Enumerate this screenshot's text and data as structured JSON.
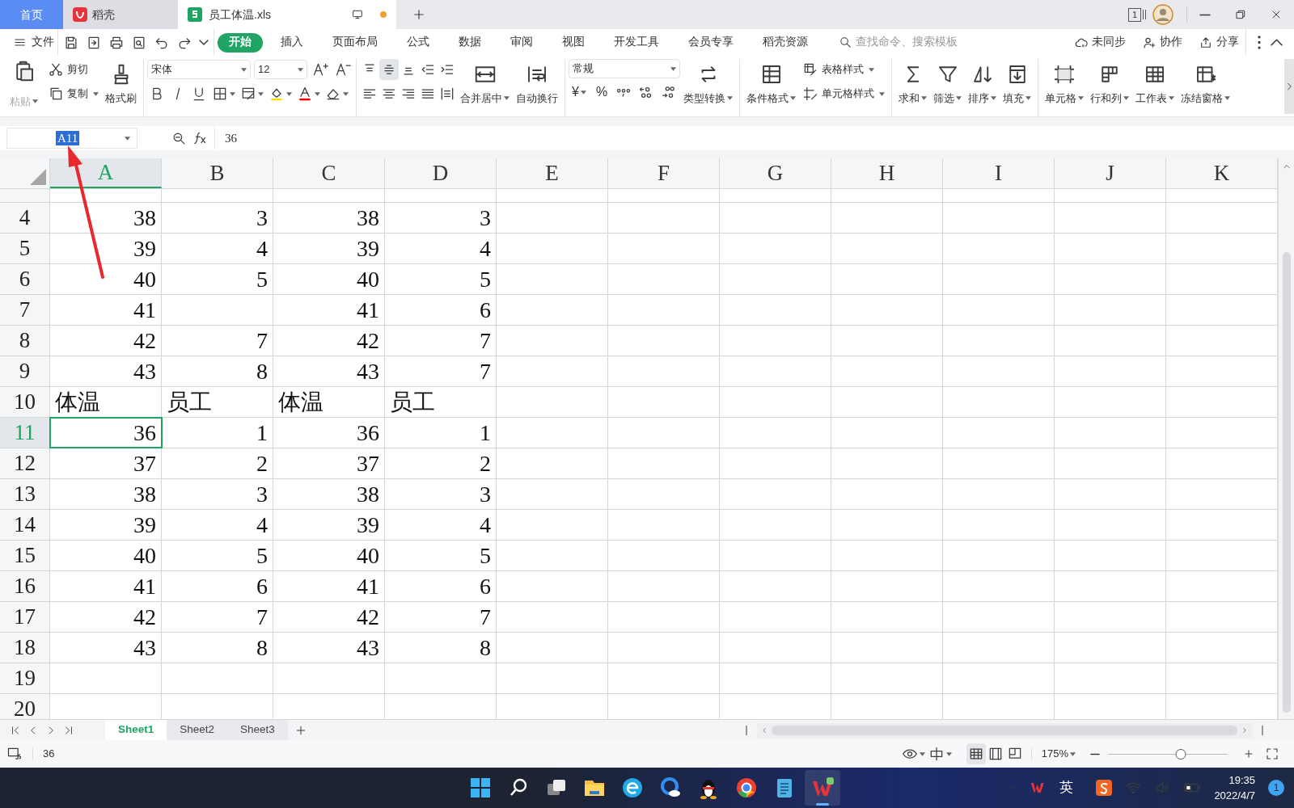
{
  "title_tabs": [
    {
      "label": "首页",
      "kind": "home",
      "selected": false
    },
    {
      "label": "稻壳",
      "kind": "docer",
      "selected": false
    },
    {
      "label": "员工体温.xls",
      "kind": "sheet",
      "selected": true
    }
  ],
  "window_controls": {
    "screen_badge": "1"
  },
  "menu": {
    "file": "文件",
    "tabs": [
      {
        "label": "开始",
        "selected": true
      },
      {
        "label": "插入",
        "selected": false
      },
      {
        "label": "页面布局",
        "selected": false
      },
      {
        "label": "公式",
        "selected": false
      },
      {
        "label": "数据",
        "selected": false
      },
      {
        "label": "审阅",
        "selected": false
      },
      {
        "label": "视图",
        "selected": false
      },
      {
        "label": "开发工具",
        "selected": false
      },
      {
        "label": "会员专享",
        "selected": false
      },
      {
        "label": "稻壳资源",
        "selected": false
      }
    ],
    "search": {
      "placeholder": "查找命令、搜索模板"
    },
    "actions": [
      "未同步",
      "协作",
      "分享"
    ]
  },
  "ribbon": {
    "paste": {
      "label": "粘贴",
      "disabled": true
    },
    "cut": "剪切",
    "copy": "复制",
    "format_painter": "格式刷",
    "font": "宋体",
    "font_size": "12",
    "vertical_align": [
      {
        "selected": false
      },
      {
        "selected": true
      },
      {
        "selected": false
      }
    ],
    "merge": "合并居中",
    "wrap": "自动换行",
    "number_format": "常规",
    "currency": "¥",
    "percent": "%",
    "convert": "类型转换",
    "conditional_format": "条件格式",
    "table_style": "表格样式",
    "cell_style": "单元格样式",
    "tools": [
      "求和",
      "筛选",
      "排序",
      "填充"
    ],
    "cell_tools": [
      "单元格",
      "行和列",
      "工作表",
      "冻结窗格"
    ]
  },
  "formula_bar": {
    "name_box": "A11",
    "formula": "36"
  },
  "sheet": {
    "columns": [
      {
        "label": "A",
        "selected": true
      },
      {
        "label": "B",
        "selected": false
      },
      {
        "label": "C",
        "selected": false
      },
      {
        "label": "D",
        "selected": false
      },
      {
        "label": "E",
        "selected": false
      },
      {
        "label": "F",
        "selected": false
      },
      {
        "label": "G",
        "selected": false
      },
      {
        "label": "H",
        "selected": false
      },
      {
        "label": "I",
        "selected": false
      },
      {
        "label": "J",
        "selected": false
      },
      {
        "label": "K",
        "selected": false
      }
    ],
    "rows": [
      {
        "number": "4",
        "kind": "values",
        "selected": false,
        "cells": [
          "38",
          "3",
          "38",
          "3"
        ]
      },
      {
        "number": "5",
        "kind": "values",
        "selected": false,
        "cells": [
          "39",
          "4",
          "39",
          "4"
        ]
      },
      {
        "number": "6",
        "kind": "values",
        "selected": false,
        "cells": [
          "40",
          "5",
          "40",
          "5"
        ]
      },
      {
        "number": "7",
        "kind": "values",
        "selected": false,
        "cells": [
          "41",
          null,
          "41",
          "6"
        ]
      },
      {
        "number": "8",
        "kind": "values",
        "selected": false,
        "cells": [
          "42",
          "7",
          "42",
          "7"
        ]
      },
      {
        "number": "9",
        "kind": "values",
        "selected": false,
        "cells": [
          "43",
          "8",
          "43",
          "7"
        ]
      },
      {
        "number": "10",
        "kind": "labels",
        "selected": false,
        "cells": [
          "体温",
          "员工",
          "体温",
          "员工"
        ]
      },
      {
        "number": "11",
        "kind": "values",
        "selected": true,
        "cells": [
          "36",
          "1",
          "36",
          "1"
        ]
      },
      {
        "number": "12",
        "kind": "values",
        "selected": false,
        "cells": [
          "37",
          "2",
          "37",
          "2"
        ]
      },
      {
        "number": "13",
        "kind": "values",
        "selected": false,
        "cells": [
          "38",
          "3",
          "38",
          "3"
        ]
      },
      {
        "number": "14",
        "kind": "values",
        "selected": false,
        "cells": [
          "39",
          "4",
          "39",
          "4"
        ]
      },
      {
        "number": "15",
        "kind": "values",
        "selected": false,
        "cells": [
          "40",
          "5",
          "40",
          "5"
        ]
      },
      {
        "number": "16",
        "kind": "values",
        "selected": false,
        "cells": [
          "41",
          "6",
          "41",
          "6"
        ]
      },
      {
        "number": "17",
        "kind": "values",
        "selected": false,
        "cells": [
          "42",
          "7",
          "42",
          "7"
        ]
      },
      {
        "number": "18",
        "kind": "values",
        "selected": false,
        "cells": [
          "43",
          "8",
          "43",
          "8"
        ]
      },
      {
        "number": "19",
        "kind": "values",
        "selected": false
      },
      {
        "number": "20",
        "kind": "values",
        "selected": false
      }
    ]
  },
  "sheet_tabs": [
    {
      "label": "Sheet1",
      "selected": true
    },
    {
      "label": "Sheet2",
      "selected": false
    },
    {
      "label": "Sheet3",
      "selected": false
    }
  ],
  "status_bar": {
    "value": "36",
    "zoom": "175%",
    "zoom_slider": {
      "level": 0.61
    }
  },
  "taskbar": {
    "ime": "英",
    "time": "19:35",
    "date": "2022/4/7",
    "notifications": "1"
  }
}
